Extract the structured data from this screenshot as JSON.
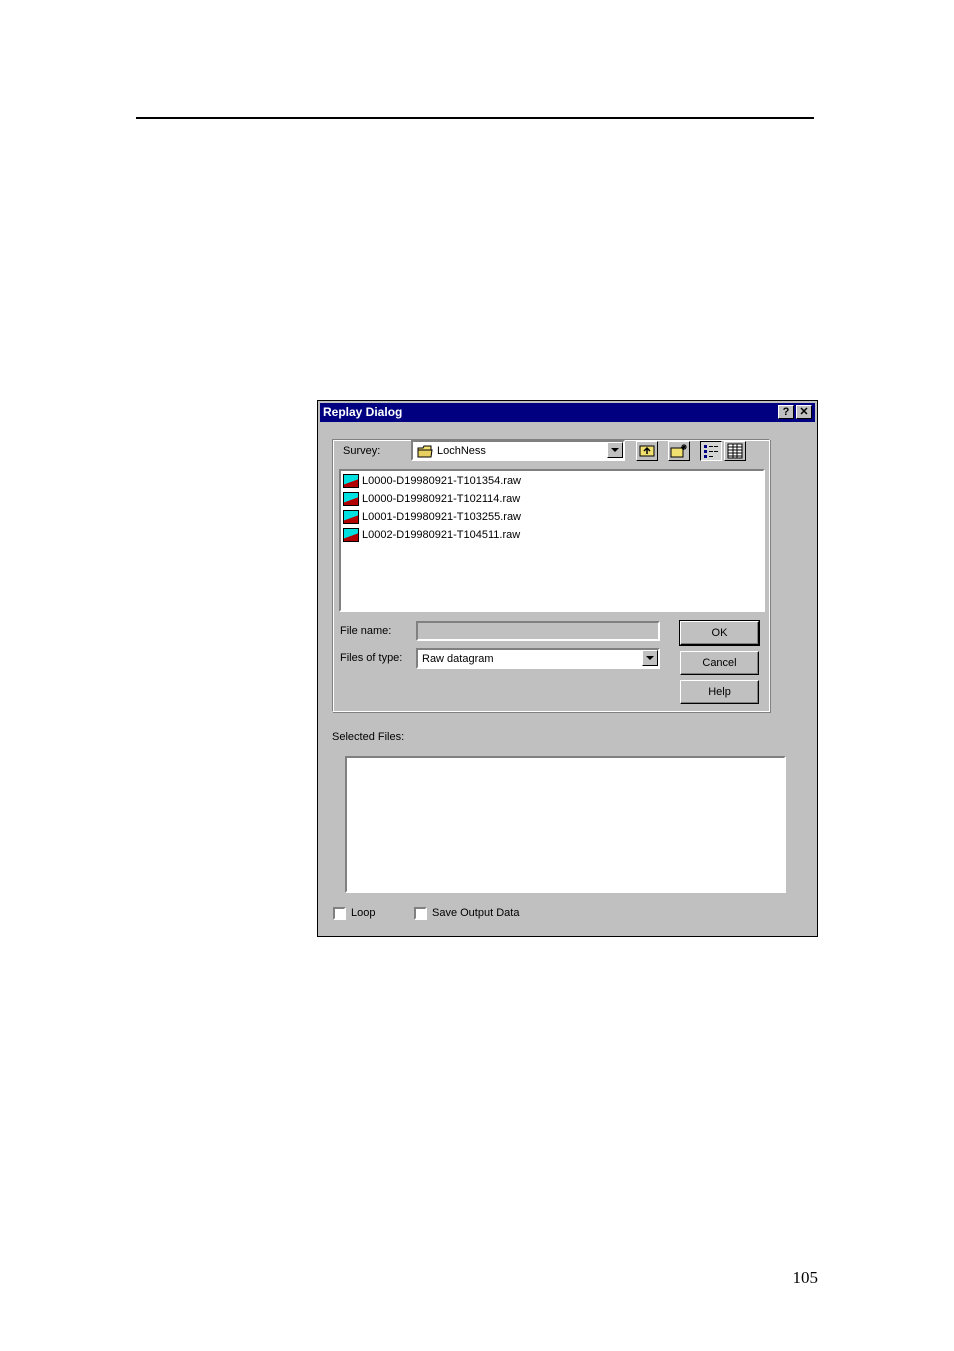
{
  "page": {
    "number": "105"
  },
  "dialog": {
    "title": "Replay Dialog",
    "help_glyph": "?",
    "close_glyph": "✕",
    "survey_label": "Survey:",
    "survey_value": "LochNess",
    "files": [
      "L0000-D19980921-T101354.raw",
      "L0000-D19980921-T102114.raw",
      "L0001-D19980921-T103255.raw",
      "L0002-D19980921-T104511.raw"
    ],
    "file_name_label": "File name:",
    "file_name_value": "",
    "files_of_type_label": "Files of type:",
    "files_of_type_value": "Raw datagram",
    "ok_label": "OK",
    "cancel_label": "Cancel",
    "help_label": "Help",
    "selected_files_label": "Selected Files:",
    "loop_label": "Loop",
    "save_output_label": "Save Output Data"
  },
  "icons": {
    "survey_folder": "folder-icon",
    "up_folder": "up-folder-icon",
    "new_folder": "new-folder-icon",
    "list_view": "list-view-icon",
    "details_view": "details-view-icon",
    "file": "raw-file-icon"
  }
}
